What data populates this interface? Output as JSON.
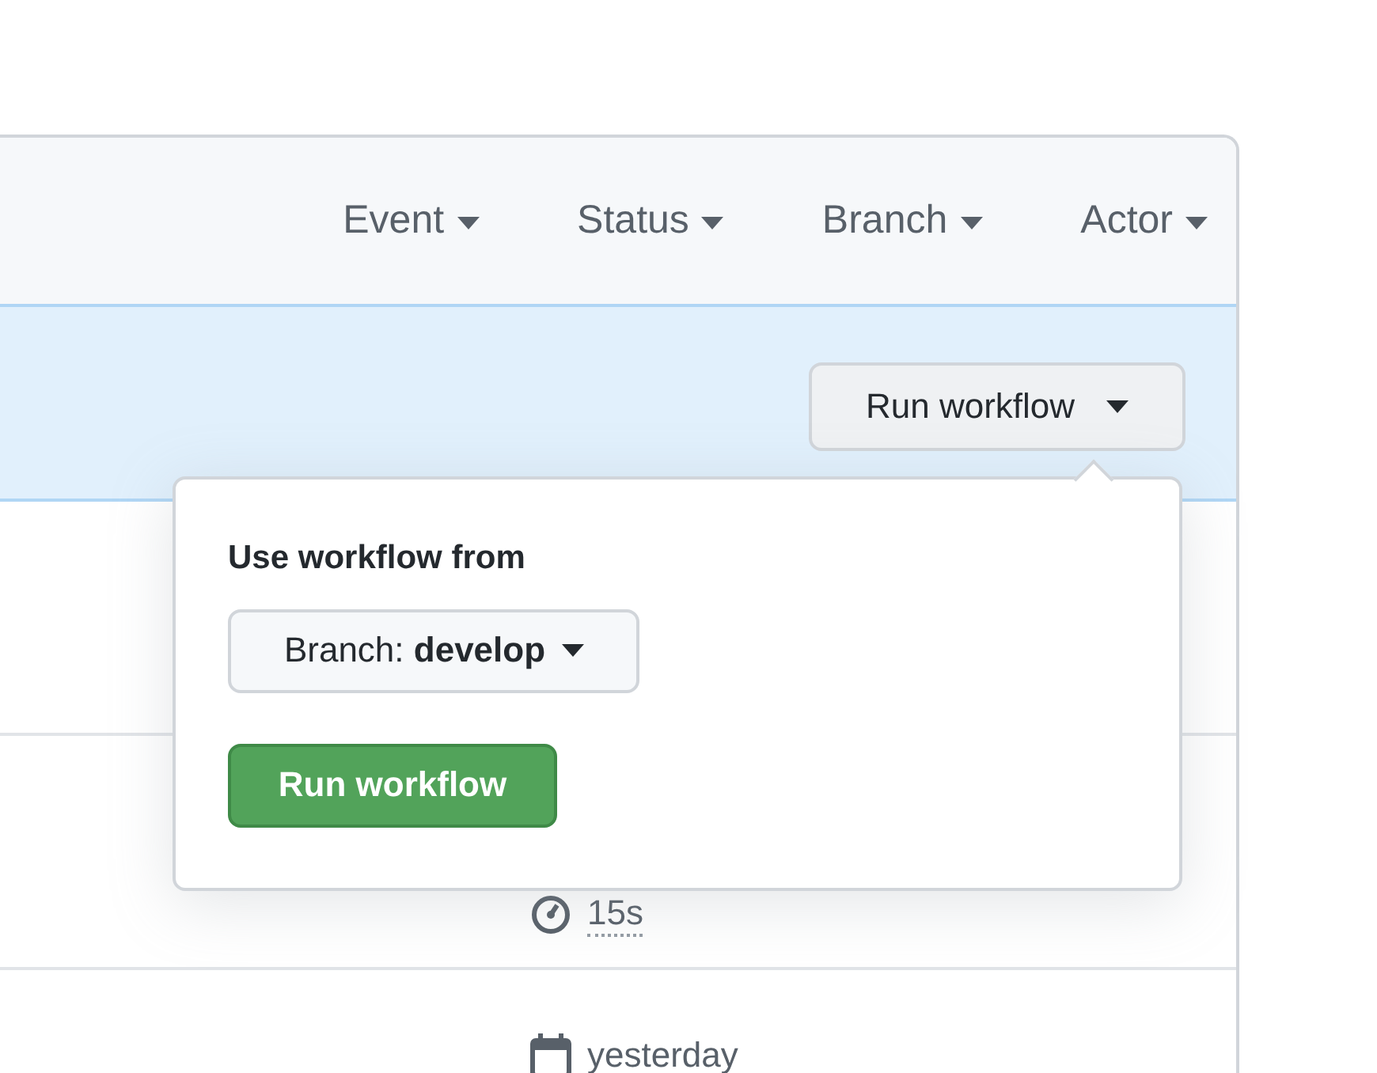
{
  "filters": [
    {
      "label": "Event"
    },
    {
      "label": "Status"
    },
    {
      "label": "Branch"
    },
    {
      "label": "Actor"
    }
  ],
  "run_button": {
    "label": "Run workflow"
  },
  "popover": {
    "title": "Use workflow from",
    "branch_button": {
      "prefix": "Branch:",
      "value": "develop"
    },
    "run_button": {
      "label": "Run workflow"
    }
  },
  "rows": [
    {
      "kind": "duration",
      "text": "15s"
    },
    {
      "kind": "date",
      "text": "yesterday"
    }
  ]
}
